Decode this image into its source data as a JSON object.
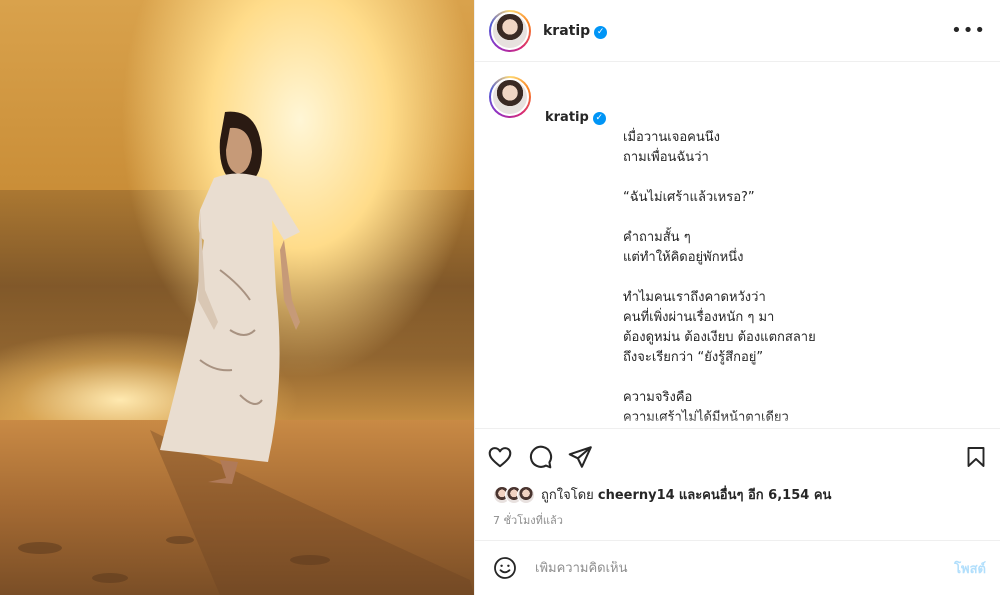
{
  "post": {
    "username": "kratip",
    "verified_mark": "✓",
    "more_label": "•••",
    "caption_lines": "เมื่อวานเจอคนนึง\nถามเพื่อนฉันว่า\n\n“ฉันไม่เศร้าแล้วเหรอ?”\n\nคำถามสั้น ๆ\nแต่ทำให้คิดอยู่พักหนึ่ง\n\nทำไมคนเราถึงคาดหวังว่า\nคนที่เพิ่งผ่านเรื่องหนัก ๆ มา\nต้องดูหม่น ต้องเงียบ ต้องแตกสลาย\nถึงจะเรียกว่า “ยังรู้สึกอยู่”\n\nความจริงคือ\nความเศร้าไม่ได้มีหน้าตาเดียว\n\nบางวันฉันทำงานได้\nยิ้มได้ หัวเราะได้",
    "caption_first": "เมื่อวานเจอคนนึง",
    "likes_prefix": "ถูกใจโดย",
    "likes_user": "cheerny14",
    "likes_suffix": "และคนอื่นๆ อีก 6,154 คน",
    "time_ago": "7 ชั่วโมงที่แล้ว",
    "comment_placeholder": "เพิ่มความคิดเห็น",
    "post_label": "โพสต์"
  },
  "icons": {
    "like": "heart-icon",
    "comment": "comment-icon",
    "share": "share-icon",
    "save": "bookmark-icon",
    "emoji": "emoji-icon",
    "more": "more-icon"
  },
  "colors": {
    "verified": "#0095f6",
    "post_button": "#b2dffc",
    "muted": "#8e8e8e"
  }
}
